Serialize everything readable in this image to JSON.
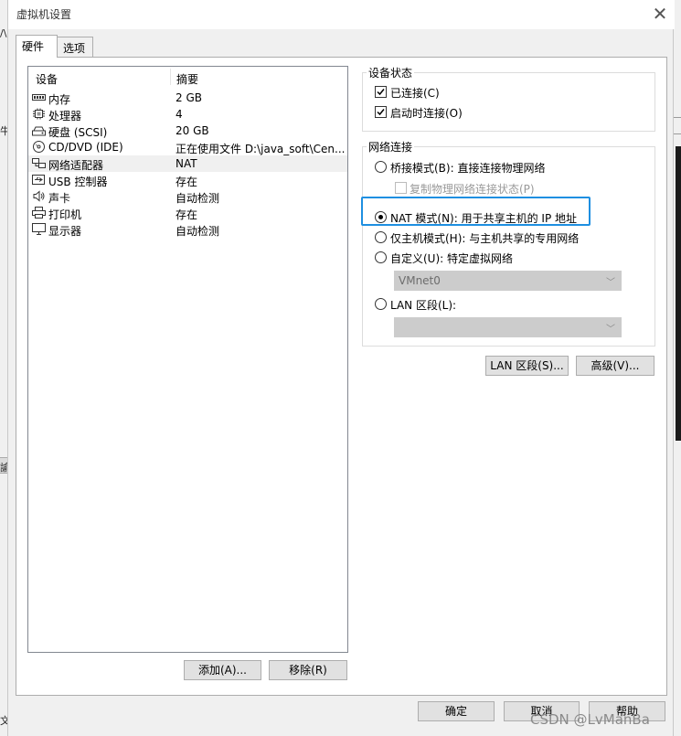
{
  "window": {
    "title": "虚拟机设置",
    "close_symbol": "✕"
  },
  "background": {
    "left_glyphs": [
      "/\\",
      "牛",
      "諭",
      "文"
    ]
  },
  "tabs": [
    {
      "label": "硬件",
      "active": true
    },
    {
      "label": "选项",
      "active": false
    }
  ],
  "device_list": {
    "headers": {
      "device": "设备",
      "summary": "摘要"
    },
    "rows": [
      {
        "icon": "memory-icon",
        "name": "内存",
        "value": "2 GB"
      },
      {
        "icon": "processor-icon",
        "name": "处理器",
        "value": "4"
      },
      {
        "icon": "hard-disk-icon",
        "name": "硬盘 (SCSI)",
        "value": "20 GB"
      },
      {
        "icon": "cd-dvd-icon",
        "name": "CD/DVD (IDE)",
        "value": "正在使用文件 D:\\java_soft\\Cen..."
      },
      {
        "icon": "network-adapter-icon",
        "name": "网络适配器",
        "value": "NAT",
        "selected": true
      },
      {
        "icon": "usb-icon",
        "name": "USB 控制器",
        "value": "存在"
      },
      {
        "icon": "speaker-icon",
        "name": "声卡",
        "value": "自动检测"
      },
      {
        "icon": "printer-icon",
        "name": "打印机",
        "value": "存在"
      },
      {
        "icon": "monitor-icon",
        "name": "显示器",
        "value": "自动检测"
      }
    ],
    "add_button": "添加(A)...",
    "remove_button": "移除(R)"
  },
  "device_status": {
    "title": "设备状态",
    "connected": {
      "label": "已连接(C)",
      "checked": true
    },
    "connect_at_power_on": {
      "label": "启动时连接(O)",
      "checked": true
    }
  },
  "network_connection": {
    "title": "网络连接",
    "bridged": {
      "label": "桥接模式(B): 直接连接物理网络",
      "selected": false
    },
    "replicate": {
      "label": "复制物理网络连接状态(P)",
      "checked": false,
      "disabled": true
    },
    "nat": {
      "label": "NAT 模式(N): 用于共享主机的 IP 地址",
      "selected": true
    },
    "host_only": {
      "label": "仅主机模式(H): 与主机共享的专用网络",
      "selected": false
    },
    "custom": {
      "label": "自定义(U): 特定虚拟网络",
      "selected": false,
      "combo_value": "VMnet0"
    },
    "lan_segment": {
      "label": "LAN 区段(L):",
      "selected": false,
      "combo_value": ""
    }
  },
  "action_buttons": {
    "lan_segments": "LAN 区段(S)...",
    "advanced": "高级(V)..."
  },
  "footer": {
    "ok": "确定",
    "cancel": "取消",
    "help": "帮助"
  },
  "watermark": "CSDN @LvManBa",
  "colors": {
    "highlight_box": "#1e8fe1",
    "selected_row": "#f0f0f0"
  }
}
